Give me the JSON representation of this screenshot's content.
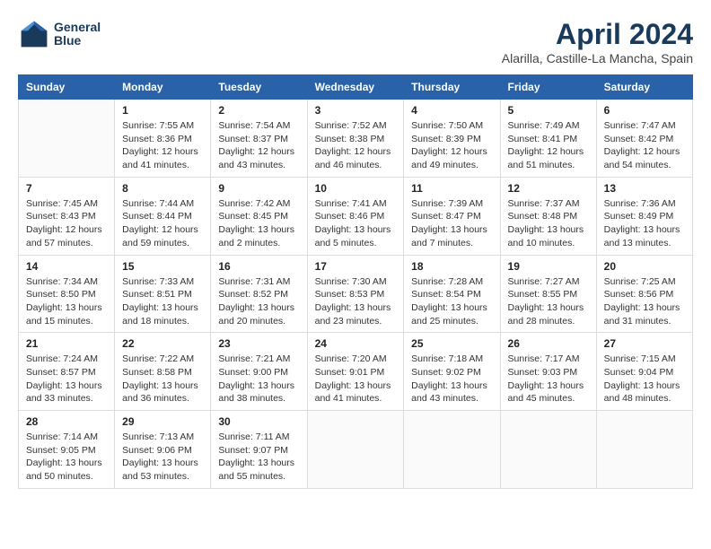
{
  "header": {
    "logo_line1": "General",
    "logo_line2": "Blue",
    "title": "April 2024",
    "subtitle": "Alarilla, Castille-La Mancha, Spain"
  },
  "columns": [
    "Sunday",
    "Monday",
    "Tuesday",
    "Wednesday",
    "Thursday",
    "Friday",
    "Saturday"
  ],
  "weeks": [
    [
      {
        "day": "",
        "info": ""
      },
      {
        "day": "1",
        "info": "Sunrise: 7:55 AM\nSunset: 8:36 PM\nDaylight: 12 hours\nand 41 minutes."
      },
      {
        "day": "2",
        "info": "Sunrise: 7:54 AM\nSunset: 8:37 PM\nDaylight: 12 hours\nand 43 minutes."
      },
      {
        "day": "3",
        "info": "Sunrise: 7:52 AM\nSunset: 8:38 PM\nDaylight: 12 hours\nand 46 minutes."
      },
      {
        "day": "4",
        "info": "Sunrise: 7:50 AM\nSunset: 8:39 PM\nDaylight: 12 hours\nand 49 minutes."
      },
      {
        "day": "5",
        "info": "Sunrise: 7:49 AM\nSunset: 8:41 PM\nDaylight: 12 hours\nand 51 minutes."
      },
      {
        "day": "6",
        "info": "Sunrise: 7:47 AM\nSunset: 8:42 PM\nDaylight: 12 hours\nand 54 minutes."
      }
    ],
    [
      {
        "day": "7",
        "info": "Sunrise: 7:45 AM\nSunset: 8:43 PM\nDaylight: 12 hours\nand 57 minutes."
      },
      {
        "day": "8",
        "info": "Sunrise: 7:44 AM\nSunset: 8:44 PM\nDaylight: 12 hours\nand 59 minutes."
      },
      {
        "day": "9",
        "info": "Sunrise: 7:42 AM\nSunset: 8:45 PM\nDaylight: 13 hours\nand 2 minutes."
      },
      {
        "day": "10",
        "info": "Sunrise: 7:41 AM\nSunset: 8:46 PM\nDaylight: 13 hours\nand 5 minutes."
      },
      {
        "day": "11",
        "info": "Sunrise: 7:39 AM\nSunset: 8:47 PM\nDaylight: 13 hours\nand 7 minutes."
      },
      {
        "day": "12",
        "info": "Sunrise: 7:37 AM\nSunset: 8:48 PM\nDaylight: 13 hours\nand 10 minutes."
      },
      {
        "day": "13",
        "info": "Sunrise: 7:36 AM\nSunset: 8:49 PM\nDaylight: 13 hours\nand 13 minutes."
      }
    ],
    [
      {
        "day": "14",
        "info": "Sunrise: 7:34 AM\nSunset: 8:50 PM\nDaylight: 13 hours\nand 15 minutes."
      },
      {
        "day": "15",
        "info": "Sunrise: 7:33 AM\nSunset: 8:51 PM\nDaylight: 13 hours\nand 18 minutes."
      },
      {
        "day": "16",
        "info": "Sunrise: 7:31 AM\nSunset: 8:52 PM\nDaylight: 13 hours\nand 20 minutes."
      },
      {
        "day": "17",
        "info": "Sunrise: 7:30 AM\nSunset: 8:53 PM\nDaylight: 13 hours\nand 23 minutes."
      },
      {
        "day": "18",
        "info": "Sunrise: 7:28 AM\nSunset: 8:54 PM\nDaylight: 13 hours\nand 25 minutes."
      },
      {
        "day": "19",
        "info": "Sunrise: 7:27 AM\nSunset: 8:55 PM\nDaylight: 13 hours\nand 28 minutes."
      },
      {
        "day": "20",
        "info": "Sunrise: 7:25 AM\nSunset: 8:56 PM\nDaylight: 13 hours\nand 31 minutes."
      }
    ],
    [
      {
        "day": "21",
        "info": "Sunrise: 7:24 AM\nSunset: 8:57 PM\nDaylight: 13 hours\nand 33 minutes."
      },
      {
        "day": "22",
        "info": "Sunrise: 7:22 AM\nSunset: 8:58 PM\nDaylight: 13 hours\nand 36 minutes."
      },
      {
        "day": "23",
        "info": "Sunrise: 7:21 AM\nSunset: 9:00 PM\nDaylight: 13 hours\nand 38 minutes."
      },
      {
        "day": "24",
        "info": "Sunrise: 7:20 AM\nSunset: 9:01 PM\nDaylight: 13 hours\nand 41 minutes."
      },
      {
        "day": "25",
        "info": "Sunrise: 7:18 AM\nSunset: 9:02 PM\nDaylight: 13 hours\nand 43 minutes."
      },
      {
        "day": "26",
        "info": "Sunrise: 7:17 AM\nSunset: 9:03 PM\nDaylight: 13 hours\nand 45 minutes."
      },
      {
        "day": "27",
        "info": "Sunrise: 7:15 AM\nSunset: 9:04 PM\nDaylight: 13 hours\nand 48 minutes."
      }
    ],
    [
      {
        "day": "28",
        "info": "Sunrise: 7:14 AM\nSunset: 9:05 PM\nDaylight: 13 hours\nand 50 minutes."
      },
      {
        "day": "29",
        "info": "Sunrise: 7:13 AM\nSunset: 9:06 PM\nDaylight: 13 hours\nand 53 minutes."
      },
      {
        "day": "30",
        "info": "Sunrise: 7:11 AM\nSunset: 9:07 PM\nDaylight: 13 hours\nand 55 minutes."
      },
      {
        "day": "",
        "info": ""
      },
      {
        "day": "",
        "info": ""
      },
      {
        "day": "",
        "info": ""
      },
      {
        "day": "",
        "info": ""
      }
    ]
  ]
}
